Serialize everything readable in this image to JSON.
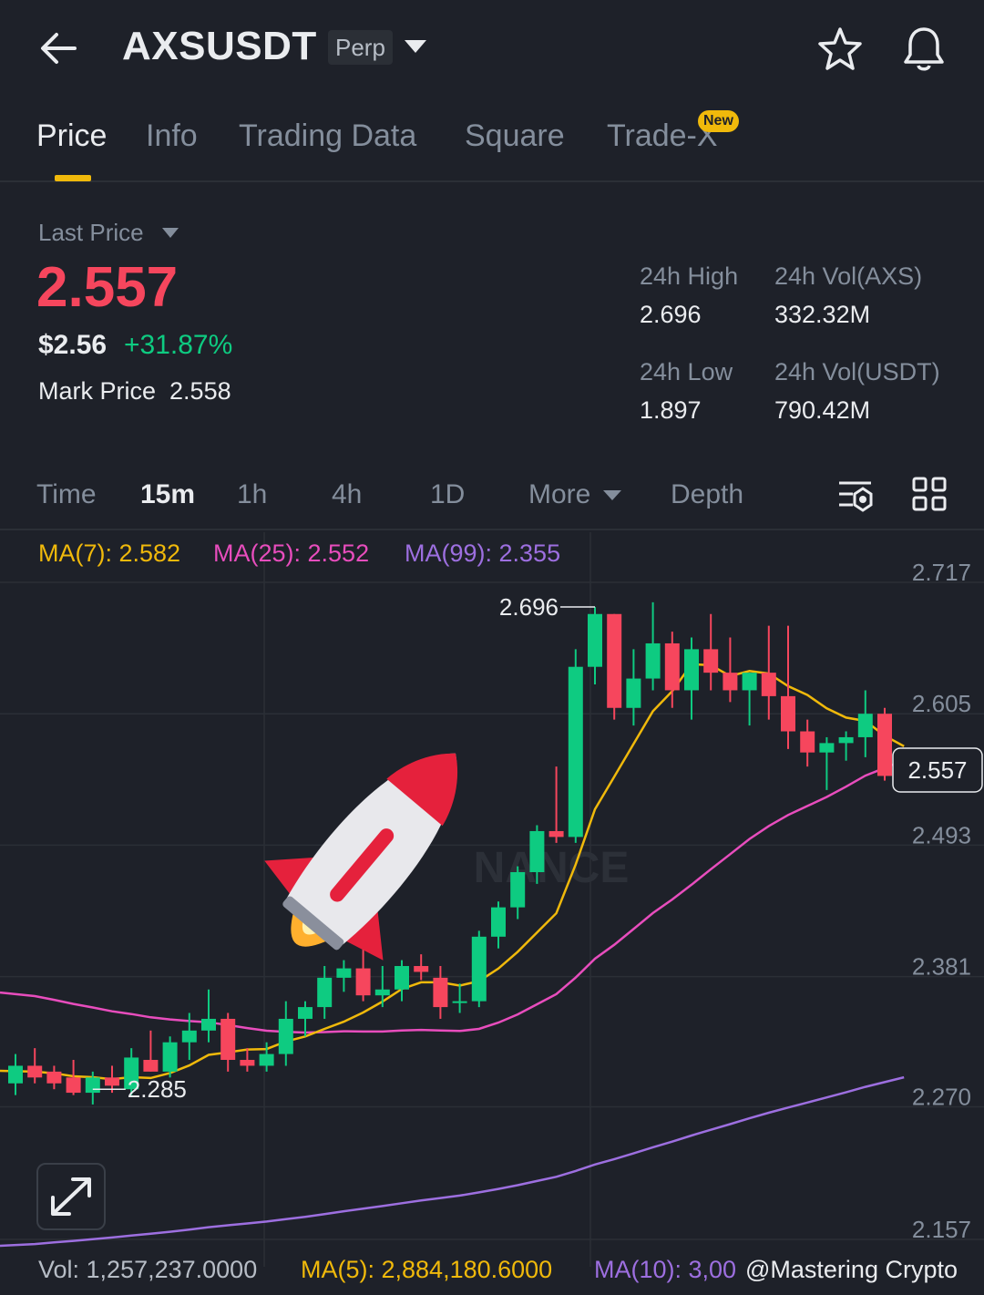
{
  "header": {
    "pair": "AXSUSDT",
    "contract_type": "Perp",
    "icons": [
      "back-arrow-icon",
      "caret-down-icon",
      "star-icon",
      "bell-icon"
    ]
  },
  "tabs": [
    {
      "label": "Price",
      "active": true
    },
    {
      "label": "Info"
    },
    {
      "label": "Trading Data"
    },
    {
      "label": "Square"
    },
    {
      "label": "Trade-X",
      "badge": "New"
    }
  ],
  "ticker": {
    "last_price_label": "Last Price",
    "last_price": "2.557",
    "usd_price": "$2.56",
    "change_pct": "+31.87%",
    "mark_price_label": "Mark Price",
    "mark_price": "2.558",
    "stats": {
      "high_label": "24h High",
      "high": "2.696",
      "vol_base_label": "24h Vol(AXS)",
      "vol_base": "332.32M",
      "low_label": "24h Low",
      "low": "1.897",
      "vol_quote_label": "24h Vol(USDT)",
      "vol_quote": "790.42M"
    }
  },
  "intervals": {
    "items": [
      "Time",
      "15m",
      "1h",
      "4h",
      "1D",
      "More",
      "Depth"
    ],
    "active": "15m"
  },
  "indicators": {
    "ma7": "MA(7): 2.582",
    "ma25": "MA(25): 2.552",
    "ma99": "MA(99): 2.355"
  },
  "volume": {
    "vol": "Vol: 1,257,237.0000",
    "ma5": "MA(5): 2,884,180.6000",
    "ma10": "MA(10): 3,00"
  },
  "watermark": "@Mastering Crypto",
  "colors": {
    "up": "#0ecb81",
    "down": "#f6465d",
    "ma7": "#f0b90b",
    "ma25": "#e84dbd",
    "ma99": "#9d6fe0",
    "accent": "#f0b90b",
    "background": "#1e2129"
  },
  "chart_data": {
    "type": "candlestick",
    "y_ticks": [
      "2.717",
      "2.605",
      "2.493",
      "2.381",
      "2.270",
      "2.157"
    ],
    "ylim": [
      2.157,
      2.717
    ],
    "current_price": "2.557",
    "high_marker": "2.696",
    "low_marker": "2.285",
    "watermark_text": "NANCE",
    "candles": [
      {
        "o": 2.29,
        "h": 2.315,
        "l": 2.28,
        "c": 2.305
      },
      {
        "o": 2.305,
        "h": 2.32,
        "l": 2.29,
        "c": 2.295
      },
      {
        "o": 2.3,
        "h": 2.305,
        "l": 2.285,
        "c": 2.29
      },
      {
        "o": 2.295,
        "h": 2.31,
        "l": 2.28,
        "c": 2.282
      },
      {
        "o": 2.282,
        "h": 2.3,
        "l": 2.272,
        "c": 2.295
      },
      {
        "o": 2.295,
        "h": 2.305,
        "l": 2.282,
        "c": 2.288
      },
      {
        "o": 2.285,
        "h": 2.32,
        "l": 2.28,
        "c": 2.312
      },
      {
        "o": 2.31,
        "h": 2.335,
        "l": 2.3,
        "c": 2.3
      },
      {
        "o": 2.3,
        "h": 2.33,
        "l": 2.295,
        "c": 2.325
      },
      {
        "o": 2.325,
        "h": 2.35,
        "l": 2.31,
        "c": 2.335
      },
      {
        "o": 2.335,
        "h": 2.37,
        "l": 2.325,
        "c": 2.345
      },
      {
        "o": 2.345,
        "h": 2.35,
        "l": 2.3,
        "c": 2.31
      },
      {
        "o": 2.31,
        "h": 2.32,
        "l": 2.3,
        "c": 2.305
      },
      {
        "o": 2.305,
        "h": 2.325,
        "l": 2.3,
        "c": 2.315
      },
      {
        "o": 2.315,
        "h": 2.36,
        "l": 2.305,
        "c": 2.345
      },
      {
        "o": 2.345,
        "h": 2.36,
        "l": 2.33,
        "c": 2.355
      },
      {
        "o": 2.355,
        "h": 2.39,
        "l": 2.345,
        "c": 2.38
      },
      {
        "o": 2.38,
        "h": 2.395,
        "l": 2.368,
        "c": 2.388
      },
      {
        "o": 2.388,
        "h": 2.41,
        "l": 2.36,
        "c": 2.365
      },
      {
        "o": 2.365,
        "h": 2.39,
        "l": 2.355,
        "c": 2.37
      },
      {
        "o": 2.37,
        "h": 2.395,
        "l": 2.36,
        "c": 2.39
      },
      {
        "o": 2.39,
        "h": 2.4,
        "l": 2.378,
        "c": 2.385
      },
      {
        "o": 2.38,
        "h": 2.39,
        "l": 2.345,
        "c": 2.355
      },
      {
        "o": 2.36,
        "h": 2.375,
        "l": 2.35,
        "c": 2.36
      },
      {
        "o": 2.36,
        "h": 2.42,
        "l": 2.355,
        "c": 2.415
      },
      {
        "o": 2.415,
        "h": 2.445,
        "l": 2.405,
        "c": 2.44
      },
      {
        "o": 2.44,
        "h": 2.475,
        "l": 2.43,
        "c": 2.47
      },
      {
        "o": 2.47,
        "h": 2.51,
        "l": 2.46,
        "c": 2.505
      },
      {
        "o": 2.505,
        "h": 2.56,
        "l": 2.495,
        "c": 2.5
      },
      {
        "o": 2.5,
        "h": 2.66,
        "l": 2.495,
        "c": 2.645
      },
      {
        "o": 2.645,
        "h": 2.696,
        "l": 2.63,
        "c": 2.69
      },
      {
        "o": 2.69,
        "h": 2.69,
        "l": 2.6,
        "c": 2.61
      },
      {
        "o": 2.61,
        "h": 2.66,
        "l": 2.595,
        "c": 2.635
      },
      {
        "o": 2.635,
        "h": 2.7,
        "l": 2.625,
        "c": 2.665
      },
      {
        "o": 2.665,
        "h": 2.675,
        "l": 2.61,
        "c": 2.625
      },
      {
        "o": 2.625,
        "h": 2.67,
        "l": 2.6,
        "c": 2.66
      },
      {
        "o": 2.66,
        "h": 2.69,
        "l": 2.625,
        "c": 2.64
      },
      {
        "o": 2.64,
        "h": 2.67,
        "l": 2.615,
        "c": 2.625
      },
      {
        "o": 2.625,
        "h": 2.64,
        "l": 2.595,
        "c": 2.64
      },
      {
        "o": 2.64,
        "h": 2.68,
        "l": 2.6,
        "c": 2.62
      },
      {
        "o": 2.62,
        "h": 2.68,
        "l": 2.575,
        "c": 2.59
      },
      {
        "o": 2.59,
        "h": 2.6,
        "l": 2.56,
        "c": 2.572
      },
      {
        "o": 2.572,
        "h": 2.585,
        "l": 2.54,
        "c": 2.58
      },
      {
        "o": 2.58,
        "h": 2.59,
        "l": 2.565,
        "c": 2.585
      },
      {
        "o": 2.585,
        "h": 2.625,
        "l": 2.568,
        "c": 2.605
      },
      {
        "o": 2.605,
        "h": 2.61,
        "l": 2.548,
        "c": 2.552
      },
      {
        "o": 2.552,
        "h": 2.57,
        "l": 2.548,
        "c": 2.557
      }
    ]
  }
}
